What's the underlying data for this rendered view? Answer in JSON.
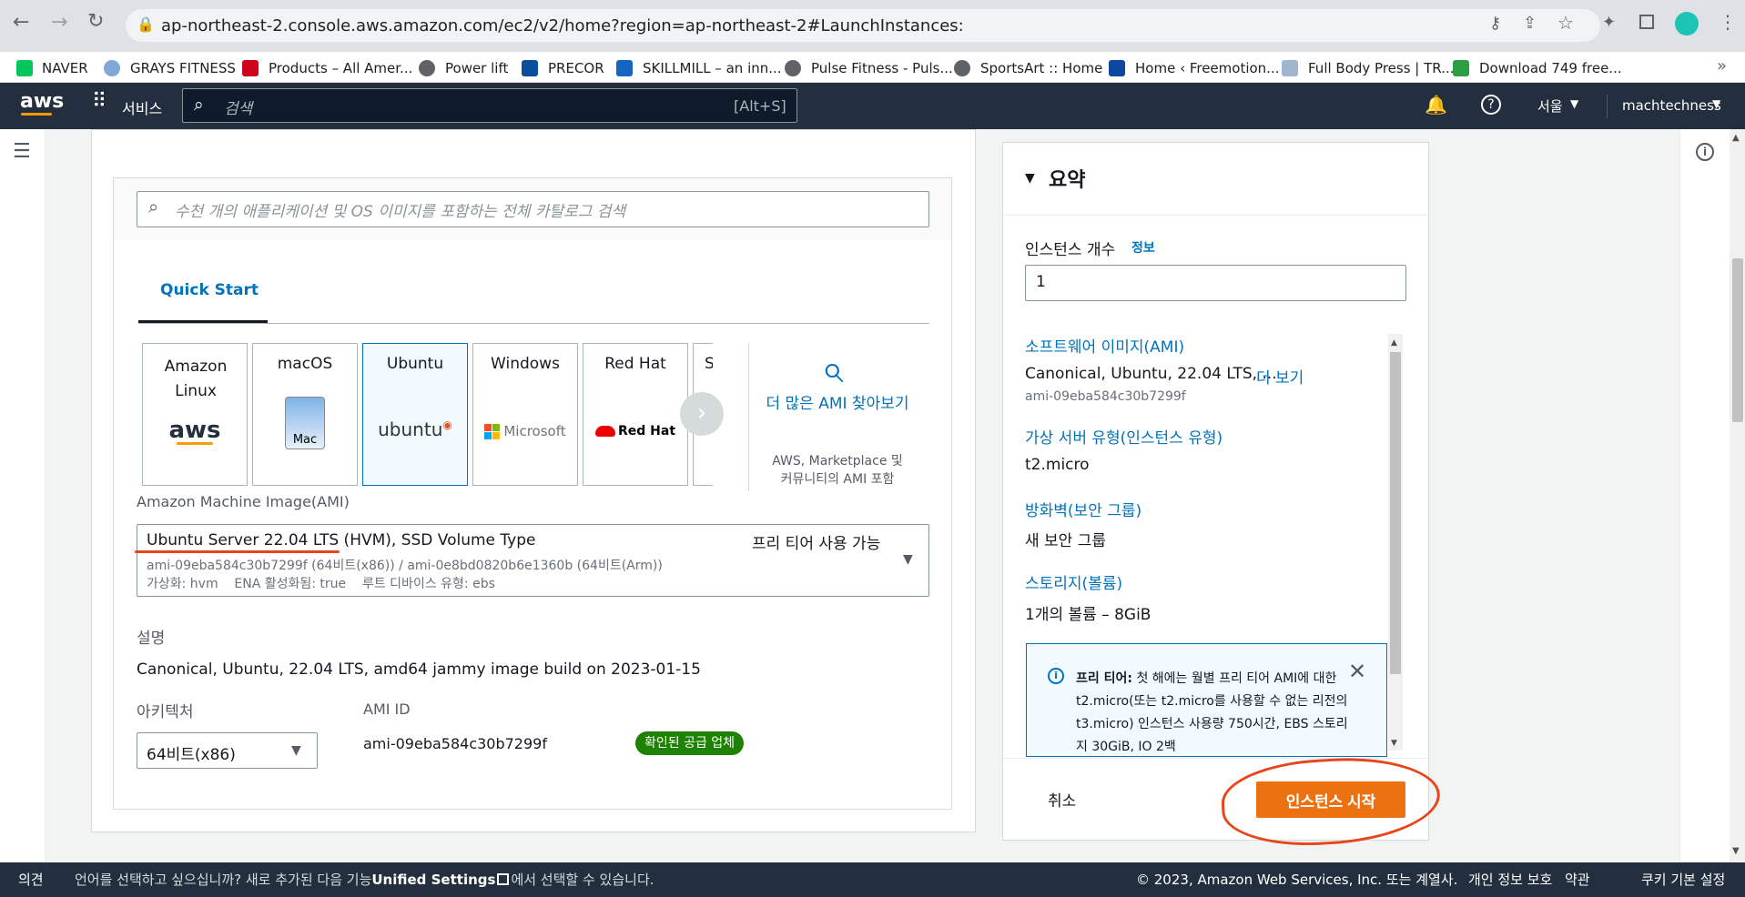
{
  "browser": {
    "url": "ap-northeast-2.console.aws.amazon.com/ec2/v2/home?region=ap-northeast-2#LaunchInstances:",
    "bookmarks": [
      "NAVER",
      "GRAYS FITNESS",
      "Products – All Amer...",
      "Power lift",
      "PRECOR",
      "SKILLMILL – an inn...",
      "Pulse Fitness - Puls...",
      "SportsArt :: Home",
      "Home ‹ Freemotion...",
      "Full Body Press | TR...",
      "Download 749 free..."
    ]
  },
  "aws_nav": {
    "logo": "aws",
    "services": "서비스",
    "search_placeholder": "검색",
    "search_shortcut": "[Alt+S]",
    "region": "서울",
    "account": "machtechness"
  },
  "ami_panel": {
    "catalog_search_placeholder": "수천 개의 애플리케이션 및 OS 이미지를 포함하는 전체 카탈로그 검색",
    "tab_quick_start": "Quick Start",
    "tiles": [
      {
        "name": "Amazon Linux",
        "logo": "aws"
      },
      {
        "name": "macOS",
        "logo": "Mac"
      },
      {
        "name": "Ubuntu",
        "logo": "ubuntu"
      },
      {
        "name": "Windows",
        "logo": "Microsoft"
      },
      {
        "name": "Red Hat",
        "logo": "Red Hat"
      },
      {
        "name": "S",
        "logo": ""
      }
    ],
    "more_ami_title": "더 많은 AMI 찾아보기",
    "more_ami_sub": "AWS, Marketplace 및 커뮤니티의 AMI 포함",
    "ami_label": "Amazon Machine Image(AMI)",
    "ami_selected_title": "Ubuntu Server 22.04 LTS (HVM), SSD Volume Type",
    "ami_free_tier": "프리 티어 사용 가능",
    "ami_ids_line": "ami-09eba584c30b7299f (64비트(x86)) / ami-0e8bd0820b6e1360b (64비트(Arm))",
    "ami_meta_line": "가상화: hvm    ENA 활성화됨: true    루트 디바이스 유형: ebs",
    "description_label": "설명",
    "description_value": "Canonical, Ubuntu, 22.04 LTS, amd64 jammy image build on 2023-01-15",
    "arch_label": "아키텍처",
    "arch_value": "64비트(x86)",
    "ami_id_label": "AMI ID",
    "ami_id_value": "ami-09eba584c30b7299f",
    "verified_badge": "확인된 공급 업체"
  },
  "summary": {
    "title": "요약",
    "count_label": "인스턴스 개수",
    "count_info": "정보",
    "count_value": "1",
    "software_image_label": "소프트웨어 이미지(AMI)",
    "software_image_value": "Canonical, Ubuntu, 22.04 LTS, ...",
    "more_link": "더 보기",
    "software_image_id": "ami-09eba584c30b7299f",
    "instance_type_label": "가상 서버 유형(인스턴스 유형)",
    "instance_type_value": "t2.micro",
    "firewall_label": "방화벽(보안 그룹)",
    "firewall_value": "새 보안 그룹",
    "storage_label": "스토리지(볼륨)",
    "storage_value": "1개의 볼륨 – 8GiB",
    "free_tier_bold": "프리 티어:",
    "free_tier_text": "첫 해에는 월별 프리 티어 AMI에 대한 t2.micro(또는 t2.micro를 사용할 수 없는 리전의 t3.micro) 인스턴스 사용량 750시간, EBS 스토리지 30GiB, IO 2백",
    "cancel": "취소",
    "launch": "인스턴스 시작"
  },
  "footer": {
    "feedback": "의견",
    "lang_text_1": "언어를 선택하고 싶으십니까? 새로 추가된 다음 기능",
    "lang_link": "Unified Settings",
    "lang_text_2": "에서 선택할 수 있습니다.",
    "copyright": "© 2023, Amazon Web Services, Inc. 또는 계열사.",
    "privacy": "개인 정보 보호",
    "terms": "약관",
    "cookie": "쿠키 기본 설정"
  },
  "colors": {
    "aws_nav": "#232f3e",
    "link": "#0073bb",
    "orange": "#ec7211",
    "badge_green": "#1d8102"
  }
}
